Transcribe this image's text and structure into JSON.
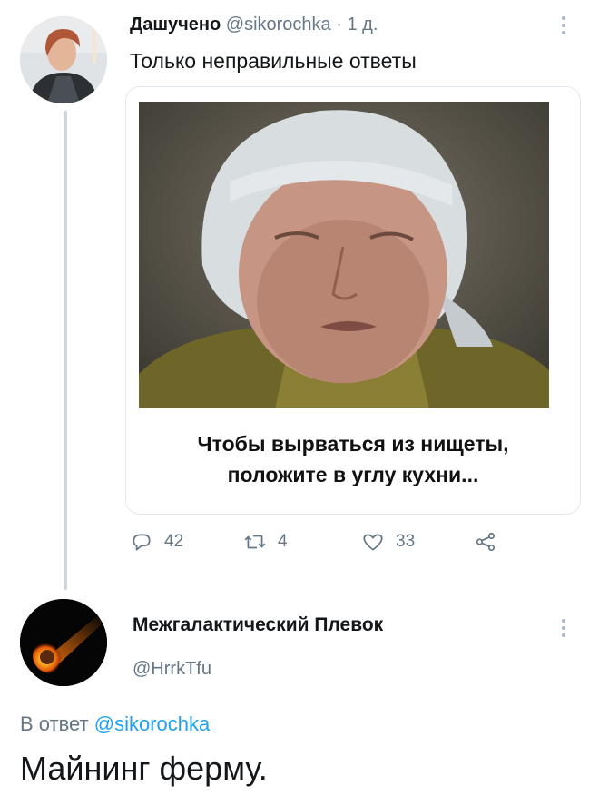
{
  "tweet1": {
    "author_name": "Дашучено",
    "handle": "@sikorochka",
    "separator": "·",
    "time": "1 д.",
    "text": "Только неправильные ответы",
    "card": {
      "caption_line1": "Чтобы вырваться из нищеты,",
      "caption_line2": "положите в углу кухни..."
    },
    "actions": {
      "replies": "42",
      "retweets": "4",
      "likes": "33"
    }
  },
  "tweet2": {
    "author_name": "Межгалактический Плевок",
    "handle": "@HrrkTfu",
    "reply_prefix": "В ответ",
    "reply_mention": "@sikorochka",
    "text": "Майнинг ферму."
  },
  "icons": {
    "reply": "reply-icon",
    "retweet": "retweet-icon",
    "like": "heart-icon",
    "share": "share-icon",
    "more": "more-vertical-icon"
  },
  "colors": {
    "accent": "#1da1f2",
    "secondary_text": "#657786",
    "thread_line": "#ccd6dd"
  }
}
